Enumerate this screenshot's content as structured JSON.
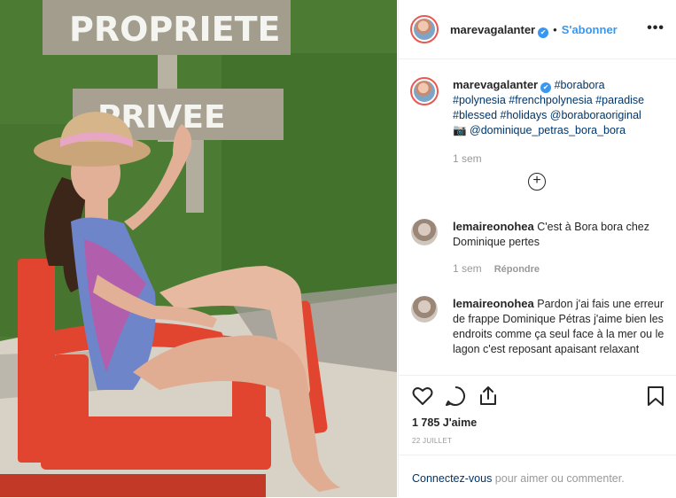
{
  "post": {
    "sign_top": "PROPRIETE",
    "sign_bottom": "PRIVEE"
  },
  "header": {
    "username": "marevagalanter",
    "verified_badge": "✔",
    "separator": "•",
    "follow_label": "S'abonner",
    "more_icon": "•••"
  },
  "caption": {
    "username": "marevagalanter",
    "verified_badge": "✔",
    "tags_line1": "#borabora",
    "line2": "#polynesia #frenchpolynesia #paradise",
    "line3": "#blessed #holidays @boraboraoriginal",
    "line4": "📷 @dominique_petras_bora_bora",
    "time": "1 sem"
  },
  "load_more_icon": "+",
  "comments": [
    {
      "username": "lemaireonohea",
      "text": "C'est à Bora bora chez Dominique pertes",
      "time": "1 sem",
      "reply_label": "Répondre"
    },
    {
      "username": "lemaireonohea",
      "text": "Pardon j'ai fais une erreur de frappe Dominique Pétras j'aime bien les endroits comme ça seul face à la mer ou le lagon c'est reposant apaisant relaxant"
    }
  ],
  "actions": {
    "icons": [
      "heart-icon",
      "comment-icon",
      "share-icon",
      "bookmark-icon"
    ],
    "likes": "1 785 J'aime",
    "date": "22 JUILLET"
  },
  "footer": {
    "login_link": "Connectez-vous",
    "rest": " pour aimer ou commenter."
  },
  "colors": {
    "accent": "#3897f0",
    "link": "#003569",
    "muted": "#999999",
    "chair": "#e2452f",
    "grass": "#4f7f36"
  }
}
